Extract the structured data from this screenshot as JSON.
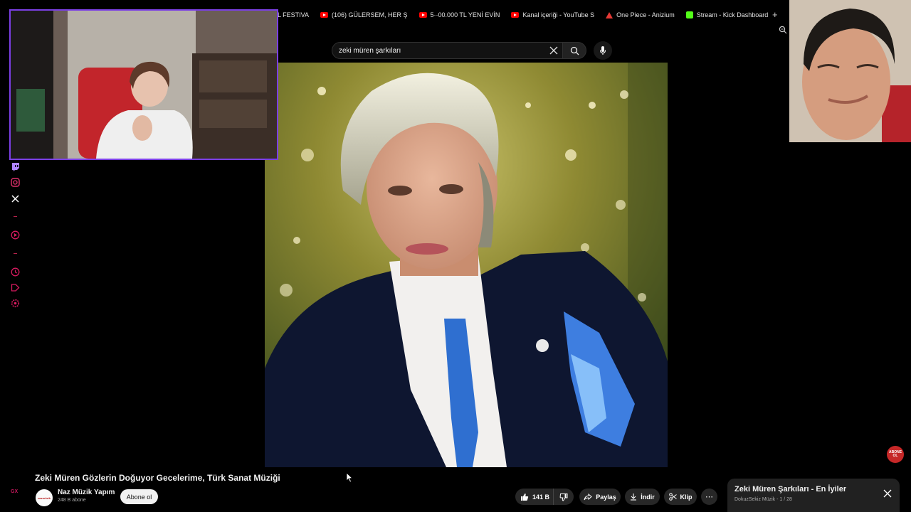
{
  "browser": {
    "tabs": [
      {
        "label": "L FESTIVA",
        "icon": "none"
      },
      {
        "label": "(106) GÜLERSEM, HER Ş",
        "icon": "youtube-icon"
      },
      {
        "label": "5··00.000 TL YENİ EVİN",
        "icon": "youtube-icon"
      },
      {
        "label": "Kanal içeriği - YouTube S",
        "icon": "youtube-icon"
      },
      {
        "label": "One Piece - Anizium",
        "icon": "anizium-icon"
      },
      {
        "label": "Stream - Kick Dashboard",
        "icon": "kick-icon"
      }
    ],
    "new_tab": "+"
  },
  "search": {
    "query": "zeki müren şarkıları"
  },
  "video": {
    "title": "Zeki Müren Gözlerin Doğuyor Gecelerime, Türk Sanat Müziği",
    "channel": {
      "name": "Naz Müzik Yapım",
      "subscribers": "248 B abone",
      "avatar_text": "nazmüzik"
    },
    "subscribe_label": "Abone ol",
    "likes": "141 B",
    "share_label": "Paylaş",
    "download_label": "İndir",
    "clip_label": "Klip",
    "watermark": "ABONE OL"
  },
  "playlist": {
    "title": "Zeki Müren Şarkıları - En İyiler",
    "subtitle": "DokuzSekiz Müzik - 1 / 28"
  },
  "overlay": {
    "rail_brand": "GX"
  },
  "colors": {
    "youtube_red": "#ff0000",
    "kick_green": "#53fc18",
    "cam_border": "#7b3fe4",
    "rail_accent": "#c2185b"
  }
}
